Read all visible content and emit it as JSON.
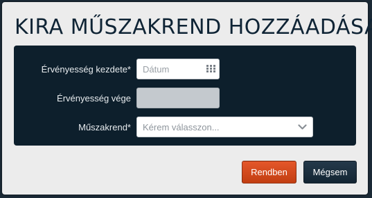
{
  "dialog": {
    "title": "KIRA MŰSZAKREND HOZZÁADÁSA"
  },
  "form": {
    "start": {
      "label": "Érvényesség kezdete*",
      "placeholder": "Dátum",
      "icon": "calendar-icon"
    },
    "end": {
      "label": "Érvényesség vége",
      "disabled": true
    },
    "shift": {
      "label": "Műszakrend*",
      "placeholder": "Kérem válasszon...",
      "icon": "chevron-down-icon"
    }
  },
  "buttons": {
    "ok": "Rendben",
    "cancel": "Mégsem"
  },
  "colors": {
    "primary_button": "#d04a1c",
    "secondary_button": "#1c3041",
    "panel_background": "#0d1f2c",
    "title_text": "#0f2435"
  }
}
